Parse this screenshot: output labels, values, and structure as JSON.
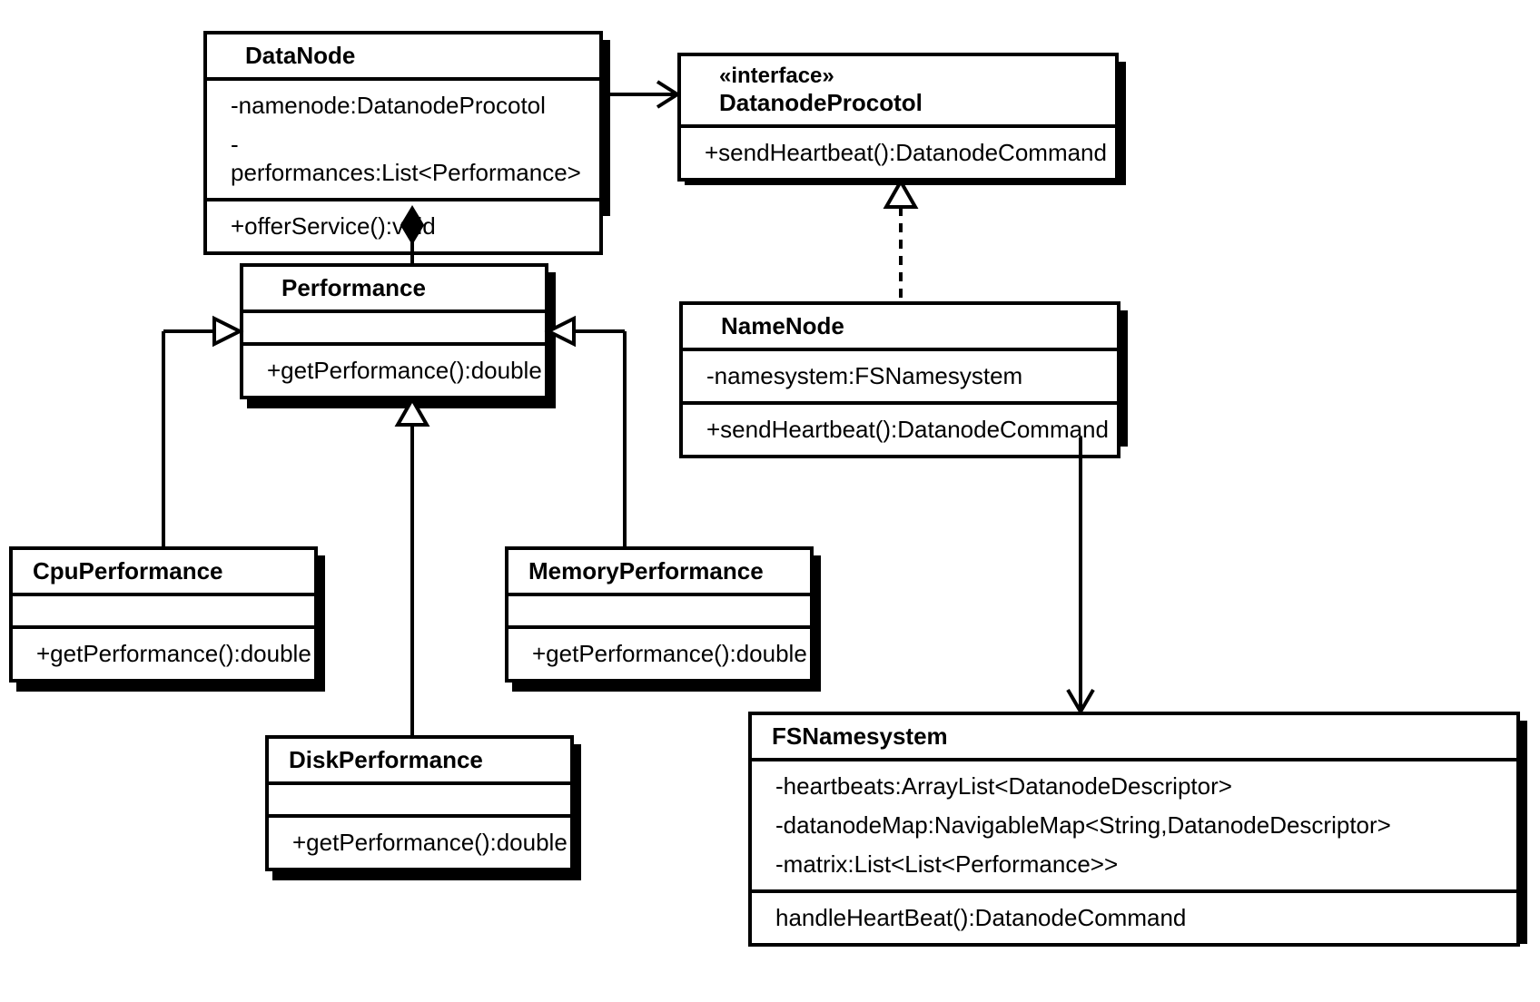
{
  "classes": {
    "DataNode": {
      "name": "DataNode",
      "attrs": [
        "-namenode:DatanodeProcotol",
        "-performances:List<Performance>"
      ],
      "ops": [
        "+offerService():void"
      ]
    },
    "DatanodeProcotol": {
      "stereotype": "«interface»",
      "name": "DatanodeProcotol",
      "ops": [
        "+sendHeartbeat():DatanodeCommand"
      ]
    },
    "Performance": {
      "name": "Performance",
      "ops": [
        "+getPerformance():double"
      ]
    },
    "NameNode": {
      "name": "NameNode",
      "attrs": [
        "-namesystem:FSNamesystem"
      ],
      "ops": [
        "+sendHeartbeat():DatanodeCommand"
      ]
    },
    "CpuPerformance": {
      "name": "CpuPerformance",
      "ops": [
        "+getPerformance():double"
      ]
    },
    "MemoryPerformance": {
      "name": "MemoryPerformance",
      "ops": [
        "+getPerformance():double"
      ]
    },
    "DiskPerformance": {
      "name": "DiskPerformance",
      "ops": [
        "+getPerformance():double"
      ]
    },
    "FSNamesystem": {
      "name": "FSNamesystem",
      "attrs": [
        "-heartbeats:ArrayList<DatanodeDescriptor>",
        "-datanodeMap:NavigableMap<String,DatanodeDescriptor>",
        "-matrix:List<List<Performance>>"
      ],
      "ops": [
        "handleHeartBeat():DatanodeCommand"
      ]
    }
  },
  "chart_data": {
    "type": "uml-class-diagram",
    "classes": [
      {
        "name": "DataNode",
        "attributes": [
          "-namenode:DatanodeProcotol",
          "-performances:List<Performance>"
        ],
        "operations": [
          "+offerService():void"
        ]
      },
      {
        "name": "DatanodeProcotol",
        "stereotype": "interface",
        "operations": [
          "+sendHeartbeat():DatanodeCommand"
        ]
      },
      {
        "name": "Performance",
        "operations": [
          "+getPerformance():double"
        ]
      },
      {
        "name": "NameNode",
        "attributes": [
          "-namesystem:FSNamesystem"
        ],
        "operations": [
          "+sendHeartbeat():DatanodeCommand"
        ]
      },
      {
        "name": "CpuPerformance",
        "operations": [
          "+getPerformance():double"
        ]
      },
      {
        "name": "MemoryPerformance",
        "operations": [
          "+getPerformance():double"
        ]
      },
      {
        "name": "DiskPerformance",
        "operations": [
          "+getPerformance():double"
        ]
      },
      {
        "name": "FSNamesystem",
        "attributes": [
          "-heartbeats:ArrayList<DatanodeDescriptor>",
          "-datanodeMap:NavigableMap<String,DatanodeDescriptor>",
          "-matrix:List<List<Performance>>"
        ],
        "operations": [
          "handleHeartBeat():DatanodeCommand"
        ]
      }
    ],
    "relationships": [
      {
        "from": "DataNode",
        "to": "DatanodeProcotol",
        "type": "association-directed"
      },
      {
        "from": "DataNode",
        "to": "Performance",
        "type": "composition"
      },
      {
        "from": "CpuPerformance",
        "to": "Performance",
        "type": "generalization"
      },
      {
        "from": "DiskPerformance",
        "to": "Performance",
        "type": "generalization"
      },
      {
        "from": "MemoryPerformance",
        "to": "Performance",
        "type": "generalization"
      },
      {
        "from": "NameNode",
        "to": "DatanodeProcotol",
        "type": "realization"
      },
      {
        "from": "NameNode",
        "to": "FSNamesystem",
        "type": "association-directed"
      }
    ]
  }
}
